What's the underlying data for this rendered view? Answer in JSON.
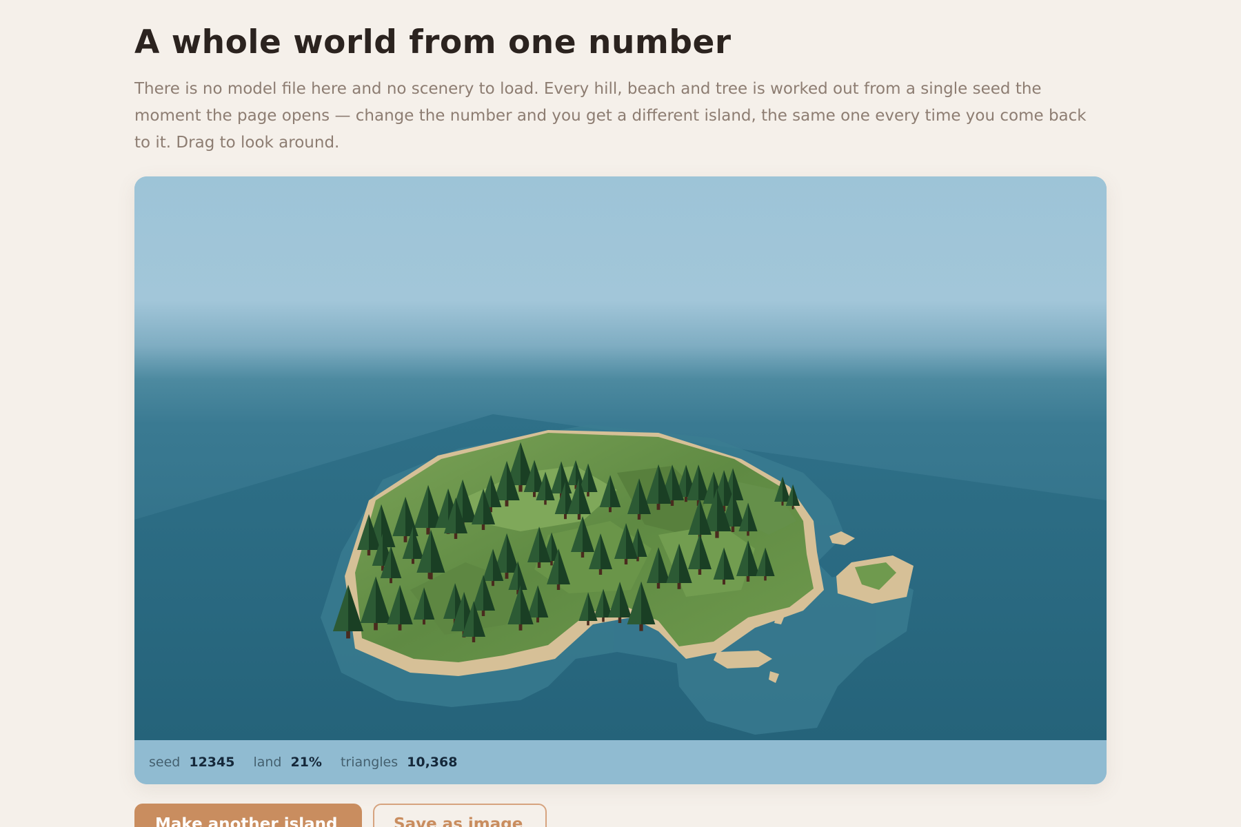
{
  "page": {
    "title": "A whole world from one number",
    "intro": "There is no model file here and no scenery to load. Every hill, beach and tree is worked out from a single seed the moment the page opens — change the number and you get a different island, the same one every time you come back to it. Drag to look around."
  },
  "viewer": {
    "stats": [
      {
        "label": "seed",
        "value": "12345"
      },
      {
        "label": "land",
        "value": "21%"
      },
      {
        "label": "triangles",
        "value": "10,368"
      }
    ]
  },
  "actions": {
    "primary_label": "Make another island",
    "secondary_label": "Save as image"
  },
  "colors": {
    "background": "#f5f0ea",
    "sky": "#9fc5d8",
    "sea": "#27667c",
    "grass": "#6a9149",
    "sand": "#d8c39a",
    "tree": "#1e4a28",
    "accent": "#c98d5f",
    "statusbar": "#90bbd1"
  }
}
